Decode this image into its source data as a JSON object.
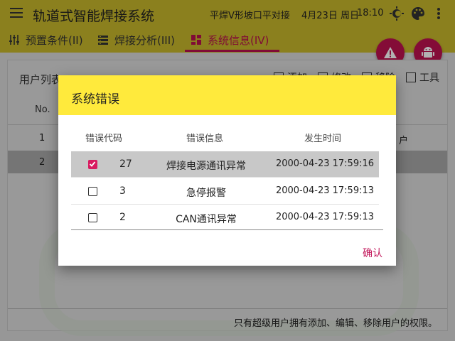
{
  "appbar": {
    "title": "轨道式智能焊接系统",
    "process": "平焊V形坡口平对接",
    "date": "4月23日 周日",
    "time": "18:10",
    "icons": [
      "menu-icon",
      "brightness-icon",
      "palette-icon",
      "more-vert-icon"
    ]
  },
  "tabs": [
    {
      "label": "预置条件(II)",
      "icon": "sliders-icon",
      "active": false
    },
    {
      "label": "焊接分析(III)",
      "icon": "list-icon",
      "active": false
    },
    {
      "label": "系统信息(IV)",
      "icon": "dashboard-icon",
      "active": true
    }
  ],
  "fabs": [
    {
      "icon": "warning-icon"
    },
    {
      "icon": "android-icon"
    }
  ],
  "background": {
    "card_title": "用户列表",
    "tools": [
      {
        "label": "添加",
        "icon": "add-file-icon"
      },
      {
        "label": "修改",
        "icon": "edit-icon"
      },
      {
        "label": "移除",
        "icon": "remove-icon"
      },
      {
        "label": "工具",
        "icon": "tools-icon"
      }
    ],
    "column_no": "No.",
    "rows": [
      {
        "no": "1",
        "tail": "户"
      },
      {
        "no": "2",
        "tail": ""
      }
    ],
    "footer_note": "只有超级用户拥有添加、编辑、移除用户的权限。"
  },
  "dialog": {
    "title": "系统错误",
    "columns": {
      "code": "错误代码",
      "message": "错误信息",
      "time": "发生时间"
    },
    "rows": [
      {
        "checked": true,
        "code": "27",
        "message": "焊接电源通讯异常",
        "time": "2000-04-23 17:59:16"
      },
      {
        "checked": false,
        "code": "3",
        "message": "急停报警",
        "time": "2000-04-23 17:59:13"
      },
      {
        "checked": false,
        "code": "2",
        "message": "CAN通讯异常",
        "time": "2000-04-23 17:59:13"
      }
    ],
    "confirm_label": "确认",
    "accent": "#ffea3c",
    "check_color": "#d81b60"
  }
}
